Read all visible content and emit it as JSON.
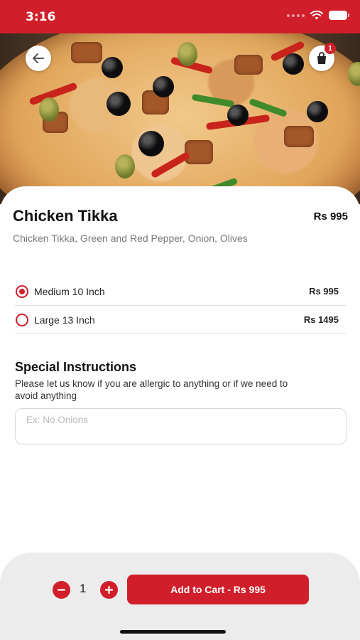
{
  "status_bar": {
    "time": "3:16"
  },
  "header": {
    "cart_badge": "1"
  },
  "product": {
    "name": "Chicken Tikka",
    "price": "Rs 995",
    "description": "Chicken Tikka, Green and Red Pepper, Onion, Olives"
  },
  "options": [
    {
      "label": "Medium 10 Inch",
      "price": "Rs 995",
      "selected": true
    },
    {
      "label": "Large 13 Inch",
      "price": "Rs 1495",
      "selected": false
    }
  ],
  "special_instructions": {
    "title": "Special Instructions",
    "text": "Please let us know if you are allergic to anything or if we need to avoid anything",
    "placeholder": "Ex: No Onions",
    "value": ""
  },
  "cart": {
    "quantity": "1",
    "add_label": "Add to Cart - Rs 995"
  },
  "colors": {
    "accent": "#d01f2a",
    "bottom_bar": "#ececec"
  }
}
